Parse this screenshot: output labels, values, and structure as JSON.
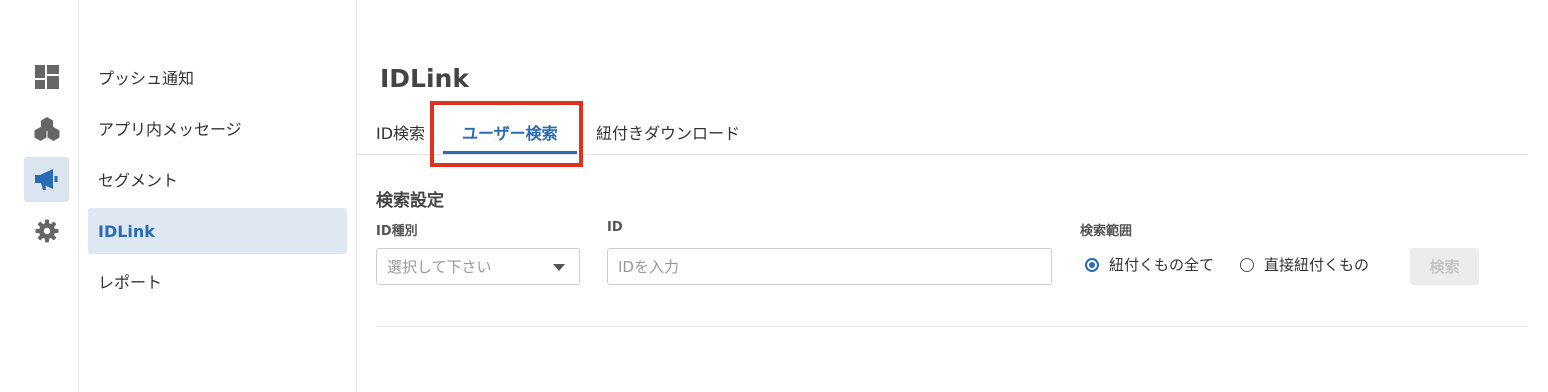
{
  "rail": {
    "items": [
      {
        "icon": "dashboard-icon",
        "active": false
      },
      {
        "icon": "cubes-icon",
        "active": false
      },
      {
        "icon": "megaphone-icon",
        "active": true
      },
      {
        "icon": "gear-icon",
        "active": false
      }
    ]
  },
  "subnav": {
    "items": [
      {
        "label": "プッシュ通知",
        "active": false
      },
      {
        "label": "アプリ内メッセージ",
        "active": false
      },
      {
        "label": "セグメント",
        "active": false
      },
      {
        "label": "IDLink",
        "active": true
      },
      {
        "label": "レポート",
        "active": false
      }
    ]
  },
  "page": {
    "title": "IDLink",
    "tabs": [
      {
        "label": "ID検索",
        "active": false
      },
      {
        "label": "ユーザー検索",
        "active": true
      },
      {
        "label": "紐付きダウンロード",
        "active": false
      }
    ]
  },
  "search": {
    "section_title": "検索設定",
    "id_type_label": "ID種別",
    "id_type_placeholder": "選択して下さい",
    "id_label": "ID",
    "id_placeholder": "IDを入力",
    "scope_label": "検索範囲",
    "scope_options": [
      {
        "label": "紐付くもの全て",
        "checked": true
      },
      {
        "label": "直接紐付くもの",
        "checked": false
      }
    ],
    "button_label": "検索",
    "button_enabled": false
  },
  "colors": {
    "accent": "#2a6bb6",
    "active_bg": "#dfe8f2",
    "highlight": "#e0301e"
  }
}
